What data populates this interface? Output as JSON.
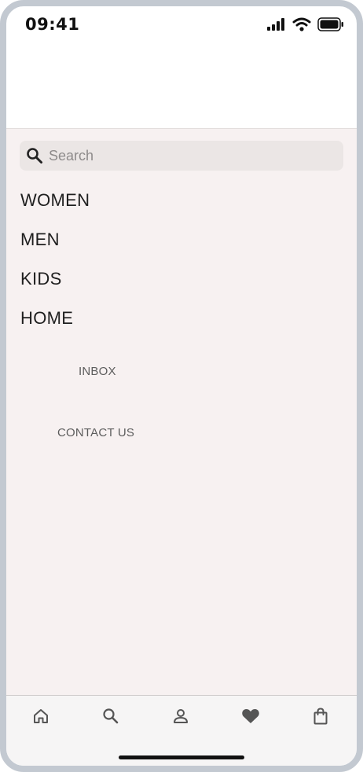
{
  "status_bar": {
    "time": "09:41"
  },
  "search": {
    "placeholder": "Search"
  },
  "menu": {
    "categories": [
      "WOMEN",
      "MEN",
      "KIDS",
      "HOME"
    ],
    "links": [
      "INBOX",
      "CONTACT US"
    ]
  },
  "tab_bar": {
    "icons": [
      "home-icon",
      "search-icon",
      "profile-icon",
      "heart-icon",
      "shopping-bag-icon"
    ]
  },
  "colors": {
    "menu_background": "#f7f1f1",
    "search_background": "#ebe6e5",
    "tab_bar_background": "#f6f5f5",
    "frame": "#c3c9d1"
  }
}
